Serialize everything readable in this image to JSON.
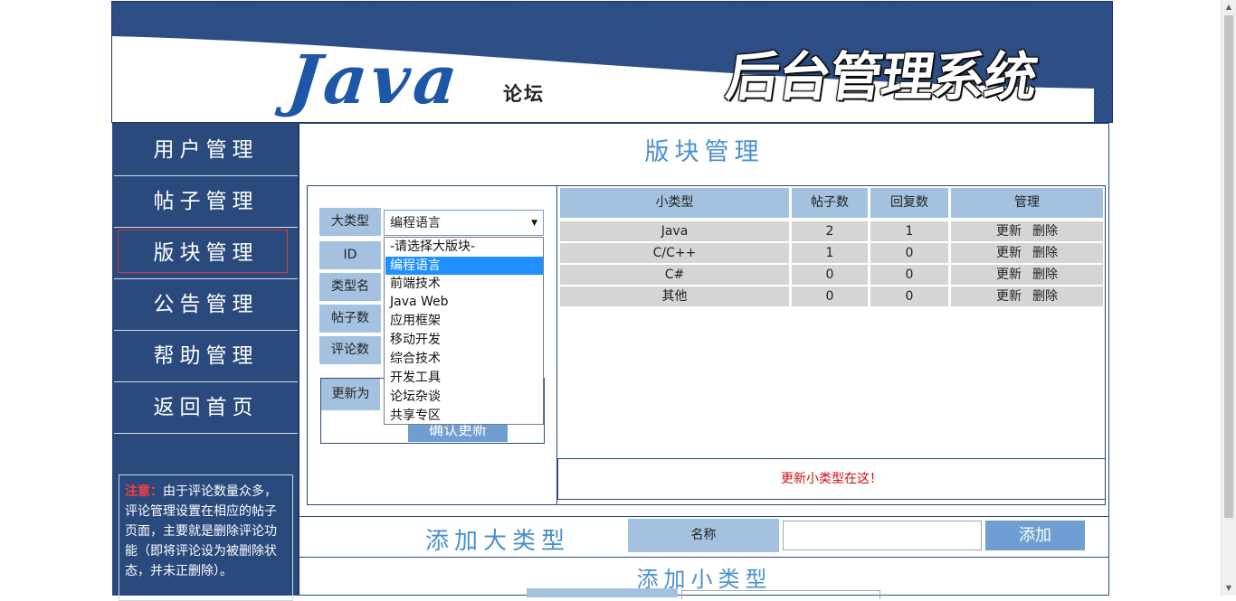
{
  "banner": {
    "logo": "Java",
    "logo_sub": "论坛",
    "system_title": "后台管理系统"
  },
  "sidebar": {
    "items": [
      {
        "label": "用户管理"
      },
      {
        "label": "帖子管理"
      },
      {
        "label": "版块管理",
        "active": true
      },
      {
        "label": "公告管理"
      },
      {
        "label": "帮助管理"
      },
      {
        "label": "返回首页"
      }
    ],
    "note_warn": "注意：",
    "note_text": "由于评论数量众多，评论管理设置在相应的帖子页面，主要就是删除评论功能（即将评论设为被删除状态，并未正删除）。"
  },
  "main": {
    "title": "版块管理",
    "form": {
      "big_type_label": "大类型",
      "id_label": "ID",
      "type_name_label": "类型名",
      "post_count_label": "帖子数",
      "comment_count_label": "评论数",
      "update_to_label": "更新为",
      "confirm_label": "确认更新",
      "selected": "编程语言",
      "options": [
        "-请选择大版块-",
        "编程语言",
        "前端技术",
        "Java Web",
        "应用框架",
        "移动开发",
        "综合技术",
        "开发工具",
        "论坛杂谈",
        "共享专区"
      ],
      "selected_index": 1
    },
    "table": {
      "headers": [
        "小类型",
        "帖子数",
        "回复数",
        "管理"
      ],
      "rows": [
        {
          "name": "Java",
          "posts": "2",
          "replies": "1"
        },
        {
          "name": "C/C++",
          "posts": "1",
          "replies": "0"
        },
        {
          "name": "C#",
          "posts": "0",
          "replies": "0"
        },
        {
          "name": "其他",
          "posts": "0",
          "replies": "0"
        }
      ],
      "update_link": "更新",
      "delete_link": "删除"
    },
    "update_note": "更新小类型在这！",
    "add_big": {
      "title": "添加大类型",
      "name_label": "名称",
      "name_value": "",
      "add_label": "添加"
    },
    "add_small": {
      "title": "添加小类型"
    }
  },
  "colors": {
    "sidebar_bg": "#2a4a7d",
    "label_bg": "#a4c2e0",
    "title_blue": "#4a8fd0",
    "button_blue": "#6f9fd0",
    "row_gray": "#d5d5d5",
    "note_red": "#d01010",
    "select_highlight": "#1e90ff"
  }
}
